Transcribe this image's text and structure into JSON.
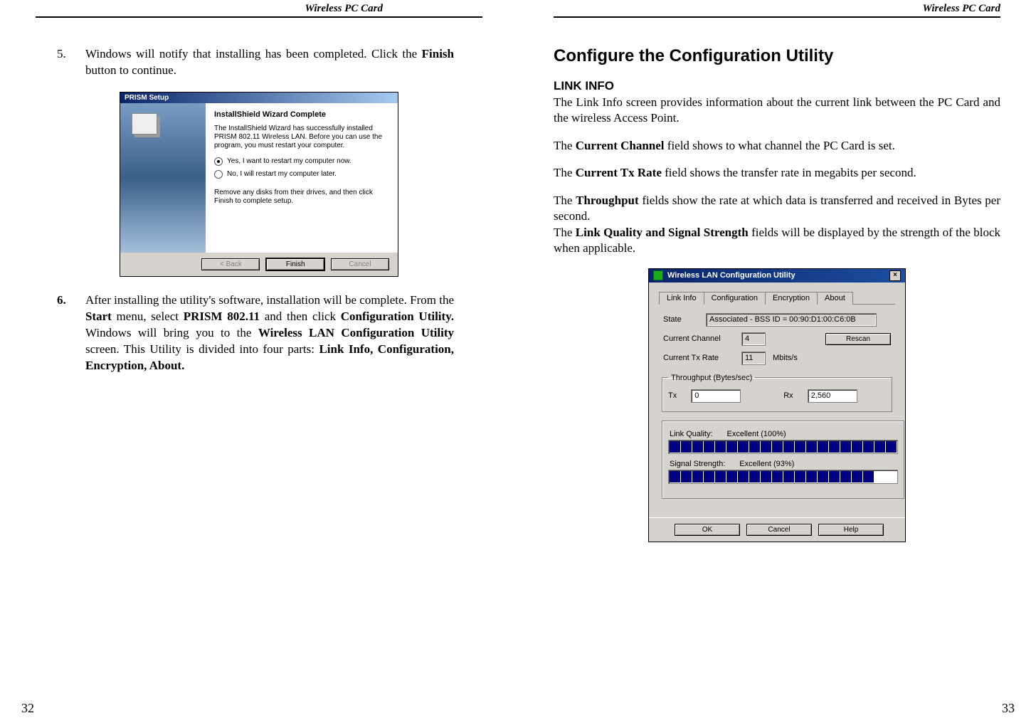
{
  "running_head": "Wireless  PC  Card",
  "left": {
    "page_number": "32",
    "step5": {
      "num": "5.",
      "text_a": "Windows will notify that installing has been completed. Click the ",
      "bold_a": "Finish",
      "text_b": " button to continue."
    },
    "step6": {
      "num": "6.",
      "t1": "After installing the utility's software, installation will be complete. From the ",
      "b1": "Start",
      "t2": " menu, select ",
      "b2": "PRISM 802.11",
      "t3": " and then click ",
      "b3": "Configuration Utility.",
      "t4": " Windows will bring you to the ",
      "b4": "Wireless LAN Configuration Utility",
      "t5": " screen. This Utility is divided into four parts: ",
      "b5": "Link Info, Configuration, Encryption, About."
    },
    "prism": {
      "title": "PRISM Setup",
      "heading": "InstallShield Wizard Complete",
      "para": "The InstallShield Wizard has successfully installed PRISM 802.11 Wireless LAN.  Before you can use the program, you must restart your computer.",
      "radio_yes": "Yes, I want to restart my computer now.",
      "radio_no": "No, I will restart my computer later.",
      "remove": "Remove any disks from their drives, and then click Finish to complete setup.",
      "btn_back": "< Back",
      "btn_finish": "Finish",
      "btn_cancel": "Cancel"
    }
  },
  "right": {
    "page_number": "33",
    "h2": "Configure the Configuration Utility",
    "h3": "LINK INFO",
    "p1": "The Link Info screen provides information about the current link between the PC Card and the wireless Access Point.",
    "p2a": "The ",
    "p2b": "Current Channel",
    "p2c": " field shows to what channel the PC Card is set.",
    "p3a": "The ",
    "p3b": "Current Tx Rate",
    "p3c": " field shows the transfer rate in megabits per second.",
    "p4a": "The ",
    "p4b": "Throughput",
    "p4c": " fields show the rate at which data is transferred and received in Bytes per second.",
    "p5a": "The ",
    "p5b": "Link Quality and Signal Strength",
    "p5c": " fields will be displayed by the strength of the block when applicable.",
    "wlan": {
      "title": "Wireless LAN Configuration Utility",
      "tabs": [
        "Link Info",
        "Configuration",
        "Encryption",
        "About"
      ],
      "state_label": "State",
      "state_value": "Associated - BSS ID = 00:90:D1:00:C6:0B",
      "channel_label": "Current Channel",
      "channel_value": "4",
      "rescan": "Rescan",
      "txrate_label": "Current Tx Rate",
      "txrate_value": "11",
      "txrate_unit": "Mbits/s",
      "throughput_legend": "Throughput (Bytes/sec)",
      "tx_label": "Tx",
      "tx_value": "0",
      "rx_label": "Rx",
      "rx_value": "2,560",
      "lq_label": "Link Quality:",
      "lq_value": "Excellent (100%)",
      "ss_label": "Signal Strength:",
      "ss_value": "Excellent (93%)",
      "btn_ok": "OK",
      "btn_cancel": "Cancel",
      "btn_help": "Help"
    }
  },
  "chart_data": {
    "type": "table",
    "title": "Wireless LAN Configuration Utility — Link Info readout",
    "fields": [
      {
        "name": "State",
        "value": "Associated - BSS ID = 00:90:D1:00:C6:0B"
      },
      {
        "name": "Current Channel",
        "value": 4
      },
      {
        "name": "Current Tx Rate (Mbits/s)",
        "value": 11
      },
      {
        "name": "Throughput Tx (Bytes/sec)",
        "value": 0
      },
      {
        "name": "Throughput Rx (Bytes/sec)",
        "value": 2560
      },
      {
        "name": "Link Quality (%)",
        "value": 100
      },
      {
        "name": "Signal Strength (%)",
        "value": 93
      }
    ]
  }
}
